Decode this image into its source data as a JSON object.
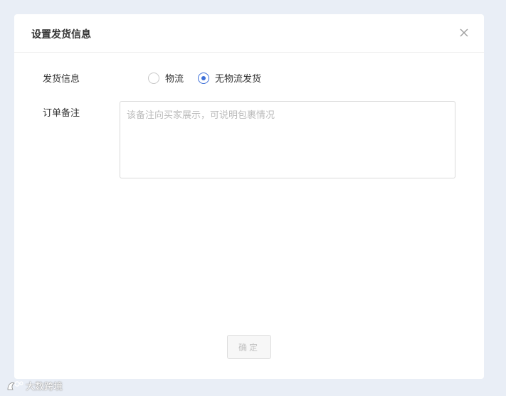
{
  "dialog": {
    "title": "设置发货信息",
    "close_icon": "close-icon"
  },
  "shipping": {
    "label": "发货信息",
    "options": [
      {
        "label": "物流",
        "checked": false
      },
      {
        "label": "无物流发货",
        "checked": true
      }
    ]
  },
  "remark": {
    "label": "订单备注",
    "value": "",
    "placeholder": "该备注向买家展示，可说明包裹情况"
  },
  "footer": {
    "confirm_label": "确定",
    "confirm_enabled": false
  },
  "watermark": {
    "text": "大数跨境",
    "icon": "brand-logo-icon"
  },
  "colors": {
    "accent": "#3d6fd8",
    "background": "#e9eef6",
    "panel": "#ffffff"
  }
}
